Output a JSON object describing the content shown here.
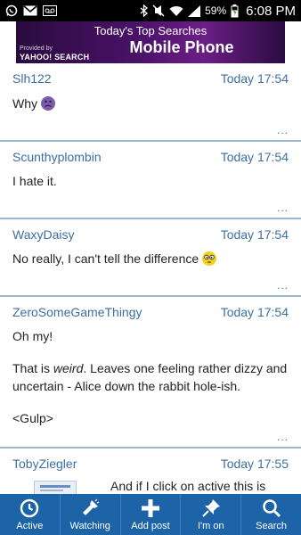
{
  "status_bar": {
    "battery_percent": "59%",
    "time": "6:08 PM"
  },
  "banner": {
    "line1": "Today's Top Searches",
    "line2": "Mobile Phone",
    "provided_by": "Provided by",
    "brand": "YAHOO! SEARCH"
  },
  "posts": [
    {
      "author": "Slh122",
      "time": "Today 17:54",
      "body": [
        "Why"
      ],
      "more": "..."
    },
    {
      "author": "Scunthyplombin",
      "time": "Today 17:54",
      "body": [
        "I hate it."
      ],
      "more": "..."
    },
    {
      "author": "WaxyDaisy",
      "time": "Today 17:54",
      "body": [
        "No really, I can't tell the difference"
      ],
      "more": "..."
    },
    {
      "author": "ZeroSomeGameThingy",
      "time": "Today 17:54",
      "body_line1": "Oh my!",
      "body_line2_before": "That is ",
      "body_line2_em": "weird",
      "body_line2_after": ". Leaves one feeling rather dizzy and uncertain - Alice down the rabbit hole-ish.",
      "body_line3": "<Gulp>",
      "more": "..."
    },
    {
      "author": "TobyZiegler",
      "time": "Today 17:55",
      "body_partial": "And if I click on active this is"
    }
  ],
  "bottom_nav": {
    "items": [
      {
        "label": "Active",
        "icon": "clock-icon"
      },
      {
        "label": "Watching",
        "icon": "flashlight-icon"
      },
      {
        "label": "Add post",
        "icon": "plus-icon"
      },
      {
        "label": "I'm on",
        "icon": "pin-icon"
      },
      {
        "label": "Search",
        "icon": "search-icon"
      }
    ]
  },
  "colors": {
    "link_blue": "#3b6fa6",
    "nav_blue": "#1d63a8",
    "divider": "#9fb8d2"
  }
}
